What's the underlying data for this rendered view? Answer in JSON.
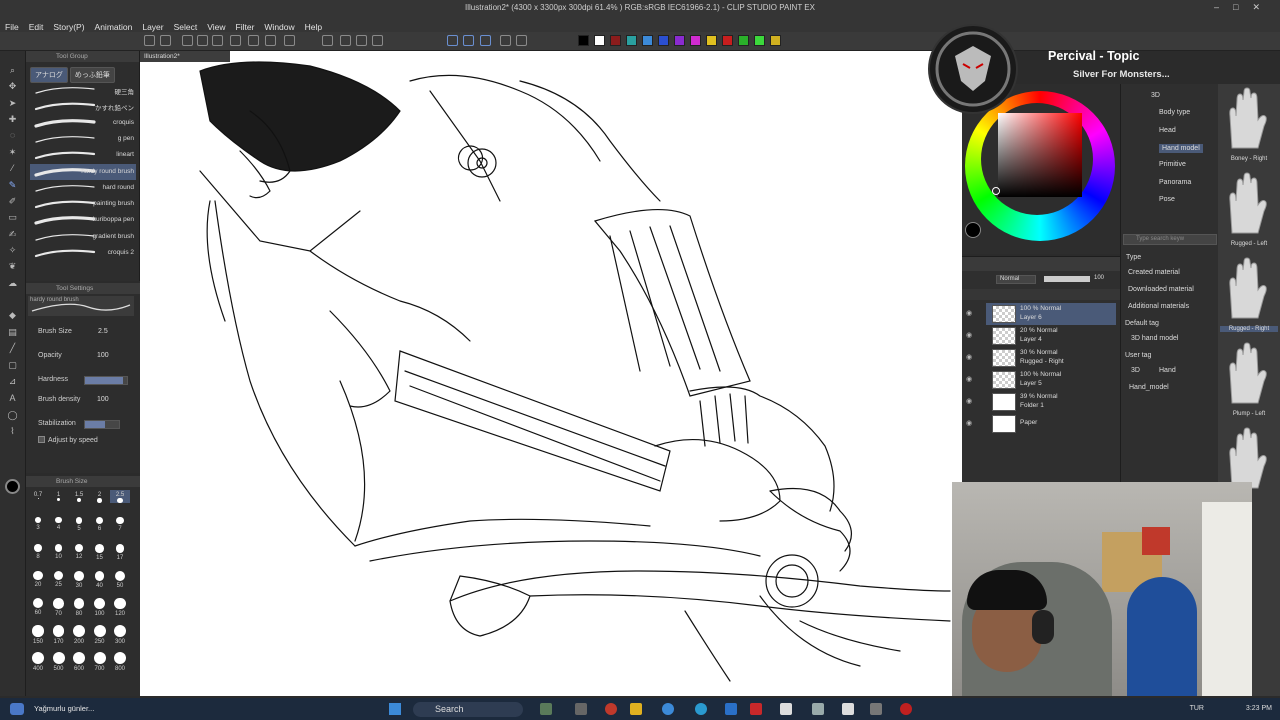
{
  "window": {
    "title": "Illustration2* (4300 x 3300px 300dpi 61.4% ) RGB:sRGB IEC61966-2.1) - CLIP STUDIO PAINT EX",
    "controls": [
      "–",
      "□",
      "✕"
    ]
  },
  "menu": [
    "File",
    "Edit",
    "Story(P)",
    "Animation",
    "Layer",
    "Select",
    "View",
    "Filter",
    "Window",
    "Help"
  ],
  "command_bar": {
    "swatches": [
      "#000000",
      "#ffffff",
      "#8b1c1c",
      "#2aa0a0",
      "#3c8ad8",
      "#2b4fd0",
      "#8a2bd0",
      "#d02bd0",
      "#e0c020",
      "#c81e1e",
      "#2ab02a",
      "#3cd83c",
      "#d0b020"
    ]
  },
  "subtool": {
    "header": "Tool Group",
    "tabs": [
      "アナログ",
      "めっふ鉛筆"
    ],
    "brushes": [
      "硬三角",
      "かすれ鉛ペン",
      "croquis",
      "g pen",
      "lineart",
      "hardy round brush",
      "hard round",
      "painting brush",
      "kuriboppa pen",
      "gradient brush",
      "croquis 2"
    ],
    "selected_index": 5
  },
  "tool_property": {
    "header": "Tool Settings",
    "preview_label": "hardy round brush",
    "brush_size_label": "Brush Size",
    "brush_size_value": "2.5",
    "opacity_label": "Opacity",
    "opacity_value": "100",
    "hardness_label": "Hardness",
    "hardness_level": 0.9,
    "density_label": "Brush density",
    "density_value": "100",
    "stabilization_label": "Stabilization",
    "stabilization_level": 0.6,
    "adjust_speed_label": "Adjust by speed"
  },
  "brush_size_palette": {
    "header": "Brush Size",
    "sizes": [
      "0.7",
      "1",
      "1.5",
      "2",
      "2.5",
      "3",
      "4",
      "5",
      "6",
      "7",
      "8",
      "10",
      "12",
      "15",
      "17",
      "20",
      "25",
      "30",
      "40",
      "50",
      "60",
      "70",
      "80",
      "100",
      "120",
      "150",
      "170",
      "200",
      "250",
      "300",
      "400",
      "500",
      "600",
      "700",
      "800"
    ],
    "selected": "2.5"
  },
  "canvas": {
    "tab": "Illustration2*"
  },
  "overlay": {
    "title": "Percival - Topic",
    "subtitle": "Silver For Monsters..."
  },
  "layers": {
    "blend_mode": "Normal",
    "opacity": "100",
    "items": [
      {
        "mode": "100 % Normal",
        "name": "Layer 6",
        "selected": true
      },
      {
        "mode": "20 % Normal",
        "name": "Layer 4",
        "selected": false
      },
      {
        "mode": "30 % Normal",
        "name": "Rugged - Right",
        "selected": false
      },
      {
        "mode": "100 % Normal",
        "name": "Layer 5",
        "selected": false
      },
      {
        "mode": "39 % Normal",
        "name": "Folder 1",
        "selected": false
      },
      {
        "mode": "",
        "name": "Paper",
        "selected": false
      }
    ]
  },
  "material": {
    "tree": [
      "3D",
      "Body type",
      "Head",
      "Hand model",
      "Primitive",
      "Panorama",
      "Pose"
    ],
    "selected_tree": "Hand model",
    "search_placeholder": "Type search keyw",
    "type_label": "Type",
    "types": [
      "Created material",
      "Downloaded material",
      "Additional materials"
    ],
    "default_tag_label": "Default tag",
    "default_tag": "3D hand model",
    "user_tag_label": "User tag",
    "user_tags": [
      "3D",
      "Hand",
      "Hand_model"
    ],
    "thumbnails": [
      "Boney - Right",
      "Rugged - Left",
      "Rugged - Right",
      "Plump - Left"
    ]
  },
  "taskbar": {
    "weather": "Yağmurlu günler...",
    "search": "Search",
    "tray_lang": "TUR",
    "time": "3:23 PM"
  }
}
